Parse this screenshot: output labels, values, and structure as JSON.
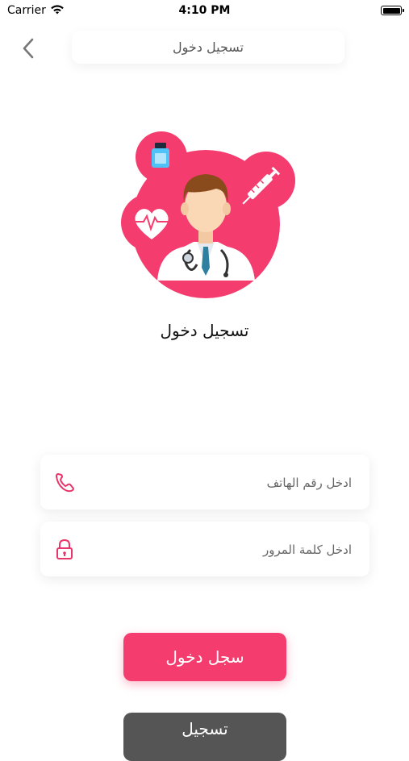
{
  "status_bar": {
    "carrier": "Carrier",
    "time": "4:10 PM",
    "icons": [
      "wifi-icon",
      "battery-icon"
    ]
  },
  "nav": {
    "back_icon": "chevron-left-icon",
    "title": "تسجيل دخول"
  },
  "illustration": {
    "description_icon": "doctor-illustration",
    "badges": [
      "medicine-bottle-icon",
      "syringe-icon",
      "heart-pulse-icon"
    ],
    "accent_color": "#f53c6e"
  },
  "page_title": "تسجيل دخول",
  "form": {
    "phone": {
      "placeholder": "ادخل رقم الهاتف",
      "value": "",
      "icon": "phone-icon"
    },
    "password": {
      "placeholder": "ادخل كلمة المرور",
      "value": "",
      "icon": "lock-icon"
    }
  },
  "buttons": {
    "login_label": "سجل دخول",
    "register_label": "تسجيل"
  },
  "colors": {
    "accent": "#f53c6e",
    "secondary_button": "#555555"
  }
}
